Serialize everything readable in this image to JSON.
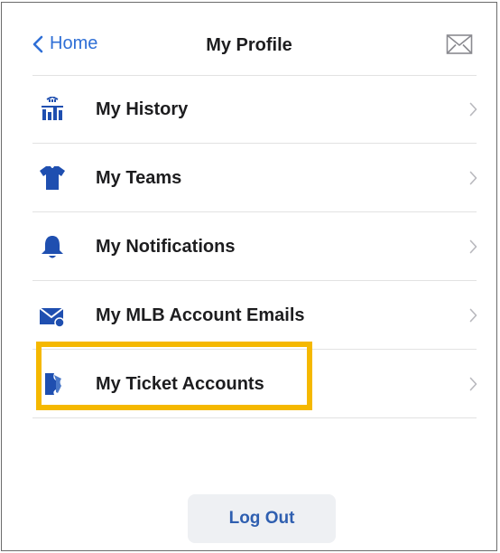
{
  "nav": {
    "back_label": "Home",
    "title": "My Profile",
    "mail_icon": "envelope-icon"
  },
  "menu": {
    "items": [
      {
        "label": "My History",
        "icon": "history-chart-icon"
      },
      {
        "label": "My Teams",
        "icon": "jersey-icon"
      },
      {
        "label": "My Notifications",
        "icon": "bell-icon"
      },
      {
        "label": "My MLB Account Emails",
        "icon": "email-icon"
      },
      {
        "label": "My Ticket Accounts",
        "icon": "ticket-icon"
      }
    ],
    "highlighted_item": "My Ticket Accounts"
  },
  "footer": {
    "logout_label": "Log Out"
  },
  "colors": {
    "accent": "#2f6fd6",
    "icon_blue": "#1f4fb0",
    "highlight": "#f5b800",
    "text": "#1d1d1f",
    "chevron": "#b8b8bd",
    "button_bg": "#eef0f3"
  }
}
